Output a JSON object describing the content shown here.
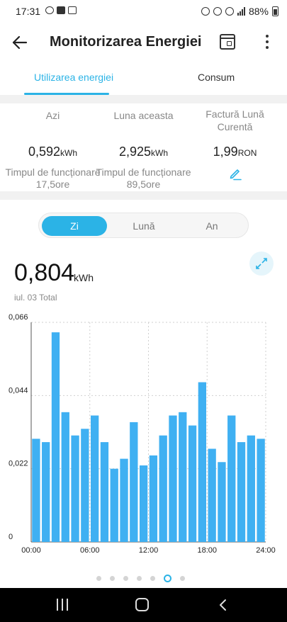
{
  "status_bar": {
    "time": "17:31",
    "battery": "88%"
  },
  "app_bar": {
    "title": "Monitorizarea Energiei"
  },
  "tabs": [
    {
      "label": "Utilizarea energiei",
      "active": true
    },
    {
      "label": "Consum",
      "active": false
    }
  ],
  "stats": [
    {
      "label": "Azi",
      "value": "0,592",
      "unit": "kWh",
      "sub": "Timpul de funcționare 17,5ore"
    },
    {
      "label": "Luna aceasta",
      "value": "2,925",
      "unit": "kWh",
      "sub": "Timpul de funcționare 89,5ore"
    },
    {
      "label": "Factură Lună Curentă",
      "value": "1,99",
      "unit": "RON"
    }
  ],
  "segments": [
    {
      "label": "Zi",
      "active": true
    },
    {
      "label": "Lună",
      "active": false
    },
    {
      "label": "An",
      "active": false
    }
  ],
  "total": {
    "value": "0,804",
    "unit": "kWh",
    "sub": "iul. 03 Total"
  },
  "accent_color": "#2bb3e6",
  "pager": {
    "count": 7,
    "active": 5
  },
  "chart_data": {
    "type": "bar",
    "title": "",
    "xlabel": "",
    "ylabel": "",
    "color": "#3fb0f2",
    "ylim": [
      0,
      0.066
    ],
    "ytick_labels": [
      "0",
      "0,022",
      "0,044",
      "0,066"
    ],
    "xtick_labels": [
      "00:00",
      "06:00",
      "12:00",
      "18:00",
      "24:00"
    ],
    "categories": [
      "00",
      "01",
      "02",
      "03",
      "04",
      "05",
      "06",
      "07",
      "08",
      "09",
      "10",
      "11",
      "12",
      "13",
      "14",
      "15",
      "16",
      "17",
      "18",
      "19",
      "20",
      "21",
      "22",
      "23"
    ],
    "values": [
      0.031,
      0.03,
      0.063,
      0.039,
      0.032,
      0.034,
      0.038,
      0.03,
      0.022,
      0.025,
      0.036,
      0.023,
      0.026,
      0.032,
      0.038,
      0.039,
      0.035,
      0.048,
      0.028,
      0.024,
      0.038,
      0.03,
      0.032,
      0.031
    ],
    "grid": true
  }
}
